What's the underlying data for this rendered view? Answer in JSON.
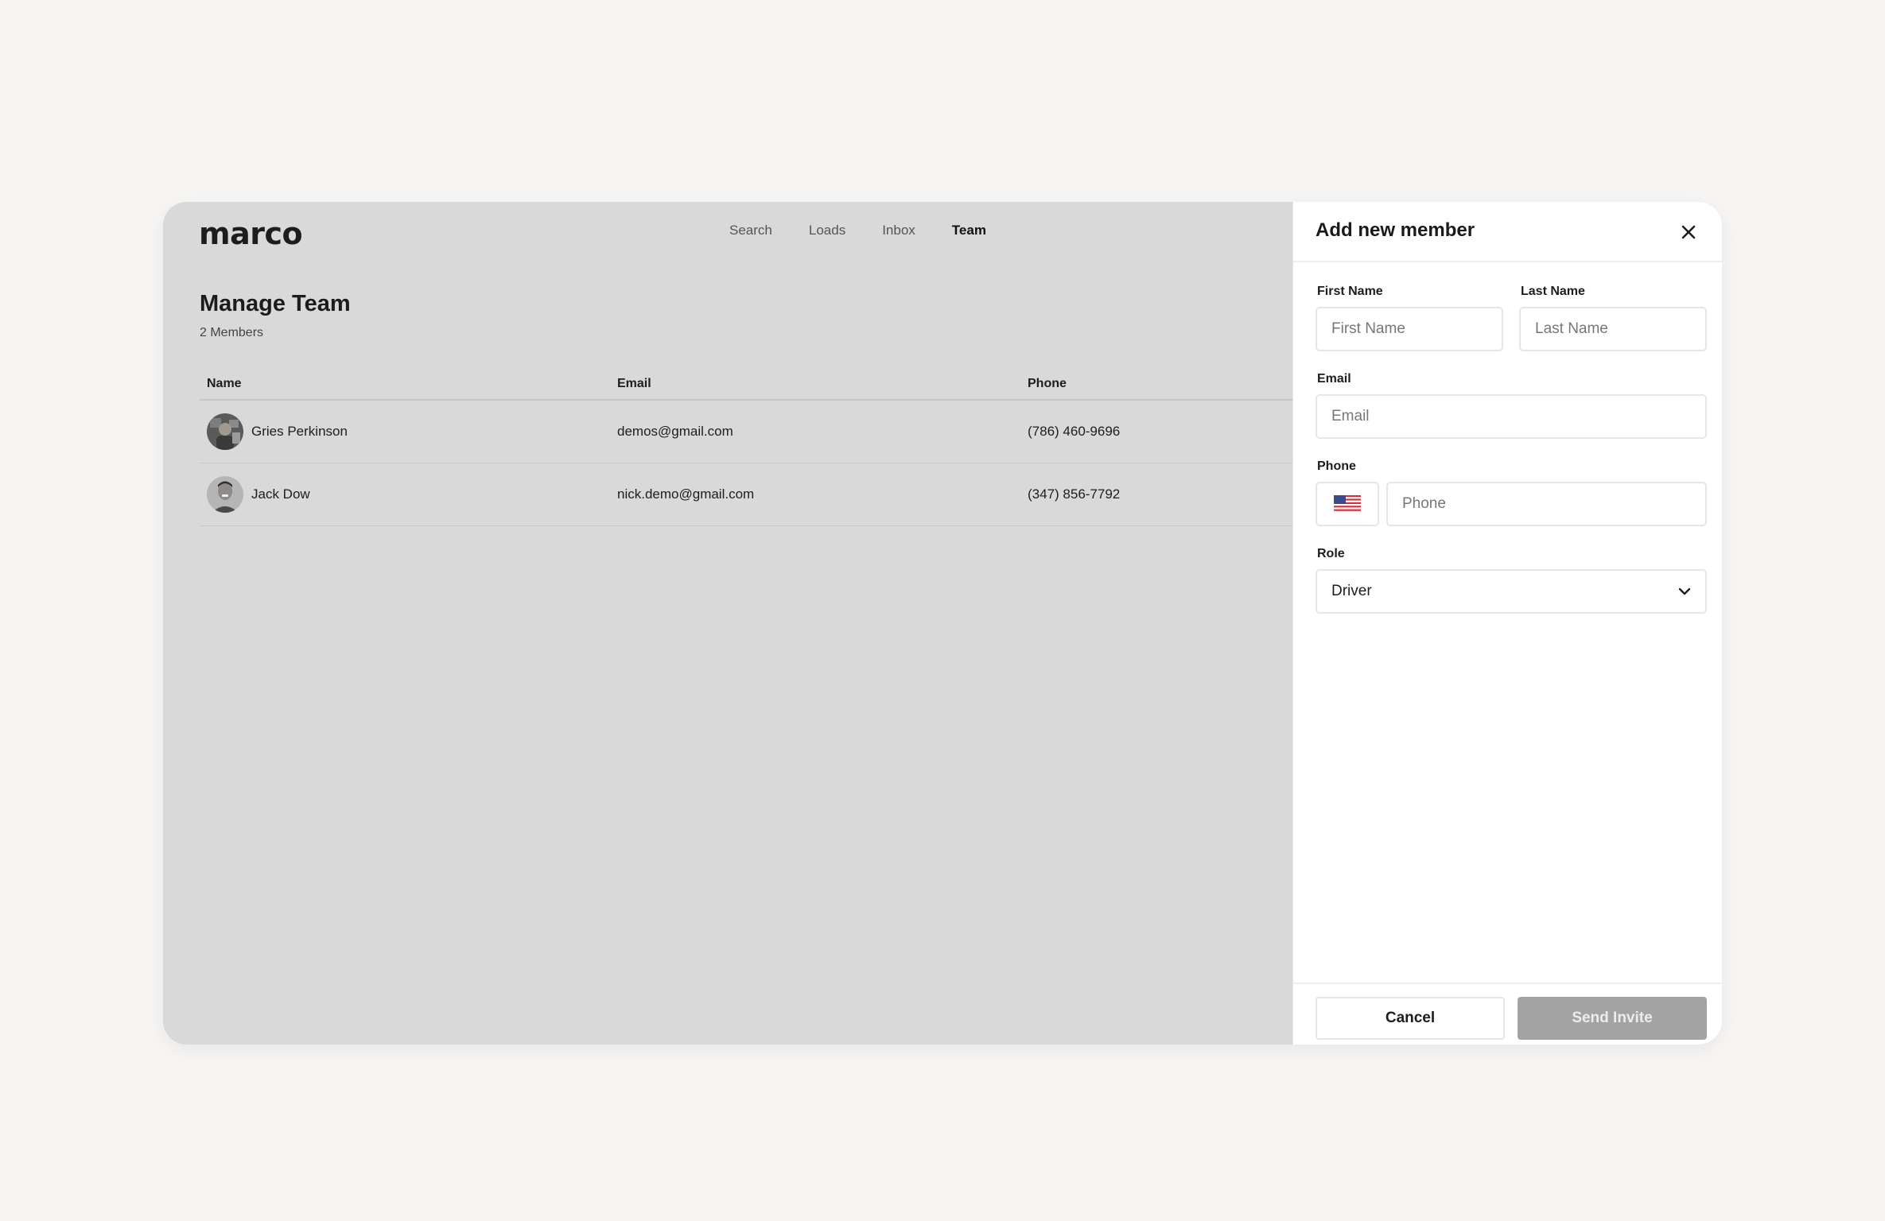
{
  "app": {
    "logo": "marco",
    "nav": [
      {
        "label": "Search"
      },
      {
        "label": "Loads"
      },
      {
        "label": "Inbox"
      },
      {
        "label": "Team",
        "active": true
      }
    ]
  },
  "team": {
    "title": "Manage Team",
    "member_count": "2 Members",
    "columns": {
      "name": "Name",
      "email": "Email",
      "phone": "Phone"
    },
    "rows": [
      {
        "name": "Gries Perkinson",
        "email": "demos@gmail.com",
        "phone": "(786) 460-9696"
      },
      {
        "name": "Jack Dow",
        "email": "nick.demo@gmail.com",
        "phone": "(347) 856-7792"
      }
    ]
  },
  "drawer": {
    "title": "Add new member",
    "close_icon": "close-icon",
    "first_name": {
      "label": "First Name",
      "placeholder": "First Name",
      "value": ""
    },
    "last_name": {
      "label": "Last Name",
      "placeholder": "Last Name",
      "value": ""
    },
    "email": {
      "label": "Email",
      "placeholder": "Email",
      "value": ""
    },
    "phone": {
      "label": "Phone",
      "placeholder": "Phone",
      "value": "",
      "country_icon": "us-flag-icon"
    },
    "role": {
      "label": "Role",
      "selected": "Driver"
    },
    "cancel_label": "Cancel",
    "send_label": "Send Invite"
  },
  "colors": {
    "page_bg": "#f6f5f3",
    "overlay_bg": "#d9d9d9",
    "send_button_disabled": "#a3a3a3"
  }
}
